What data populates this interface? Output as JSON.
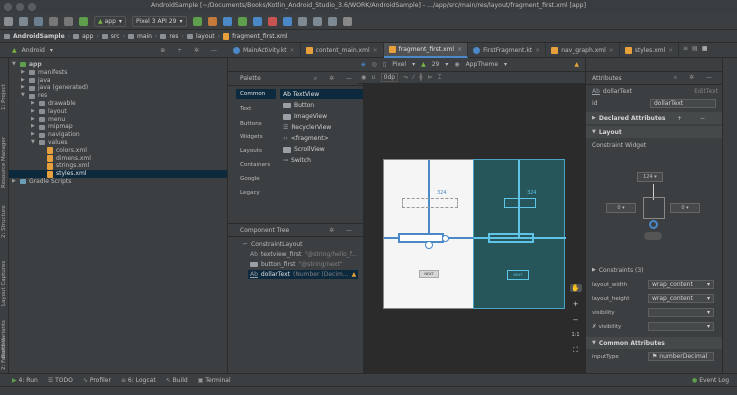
{
  "window": {
    "title": "AndroidSample [~/Documents/Books/Kotlin_Android_Studio_3.6/WORK/AndroidSample] - .../app/src/main/res/layout/fragment_first.xml [app]"
  },
  "toolbar": {
    "module_combo": "app",
    "device_combo": "Pixel 3 API 29"
  },
  "breadcrumb": [
    "AndroidSample",
    "app",
    "src",
    "main",
    "res",
    "layout",
    "fragment_first.xml"
  ],
  "project": {
    "view_combo": "Android",
    "tree": [
      {
        "label": "app",
        "level": 0
      },
      {
        "label": "manifests",
        "level": 1
      },
      {
        "label": "java",
        "level": 1
      },
      {
        "label": "java (generated)",
        "level": 1
      },
      {
        "label": "res",
        "level": 1
      },
      {
        "label": "drawable",
        "level": 2
      },
      {
        "label": "layout",
        "level": 2
      },
      {
        "label": "menu",
        "level": 2
      },
      {
        "label": "mipmap",
        "level": 2
      },
      {
        "label": "navigation",
        "level": 2
      },
      {
        "label": "values",
        "level": 2
      },
      {
        "label": "colors.xml",
        "level": 3
      },
      {
        "label": "dimens.xml",
        "level": 3
      },
      {
        "label": "strings.xml",
        "level": 3
      },
      {
        "label": "styles.xml",
        "level": 3
      },
      {
        "label": "Gradle Scripts",
        "level": 0
      }
    ]
  },
  "editor_tabs": [
    {
      "label": "MainActivity.kt"
    },
    {
      "label": "content_main.xml"
    },
    {
      "label": "fragment_first.xml"
    },
    {
      "label": "FirstFragment.kt"
    },
    {
      "label": "nav_graph.xml"
    },
    {
      "label": "styles.xml"
    }
  ],
  "side_tools": [
    "1: Project",
    "Resource Manager",
    "2: Structure",
    "Layout Captures",
    "Build Variants",
    "2: Favorites"
  ],
  "palette": {
    "title": "Palette",
    "categories": [
      "Common",
      "Text",
      "Buttons",
      "Widgets",
      "Layouts",
      "Containers",
      "Google",
      "Legacy"
    ],
    "items": [
      "Ab TextView",
      "Button",
      "ImageView",
      "RecyclerView",
      "<fragment>",
      "ScrollView",
      "Switch"
    ]
  },
  "component_tree": {
    "title": "Component Tree",
    "root": "ConstraintLayout",
    "children": [
      {
        "name": "textview_first",
        "detail": "\"@string/hello_f..."
      },
      {
        "name": "button_first",
        "detail": "\"@string/next\""
      },
      {
        "name": "dollarText",
        "detail": "(Number (Decim..."
      }
    ]
  },
  "design_toolbar": {
    "device": "Pixel",
    "api": "29",
    "theme": "AppTheme",
    "margin": "0dp"
  },
  "canvas": {
    "constraint_value_1": "324",
    "constraint_value_2": "324",
    "button_label": "NEXT"
  },
  "attributes": {
    "title": "Attributes",
    "selected_widget": "dollarText",
    "selected_type": "EditText",
    "id_label": "id",
    "id_value": "dollarText",
    "sections": {
      "declared": "Declared Attributes",
      "layout": "Layout",
      "constraints": "Constraints (3)",
      "common": "Common Attributes"
    },
    "constraint_widget_label": "Constraint Widget",
    "constraint_top": "124",
    "constraint_left": "0",
    "constraint_right": "0",
    "props": [
      {
        "name": "layout_width",
        "value": "wrap_content"
      },
      {
        "name": "layout_height",
        "value": "wrap_content"
      },
      {
        "name": "visibility",
        "value": ""
      },
      {
        "name": "visibility",
        "value": ""
      }
    ],
    "input_type_label": "inputType",
    "input_type_value": "numberDecimal"
  },
  "bottom_tools": [
    {
      "label": "4: Run"
    },
    {
      "label": "TODO"
    },
    {
      "label": "Profiler"
    },
    {
      "label": "6: Logcat"
    },
    {
      "label": "Build"
    },
    {
      "label": "Terminal"
    }
  ],
  "event_log": "Event Log",
  "colors": {
    "accent": "#4a88c7",
    "warning": "#e6a13c",
    "blueprint": "#26565a"
  }
}
